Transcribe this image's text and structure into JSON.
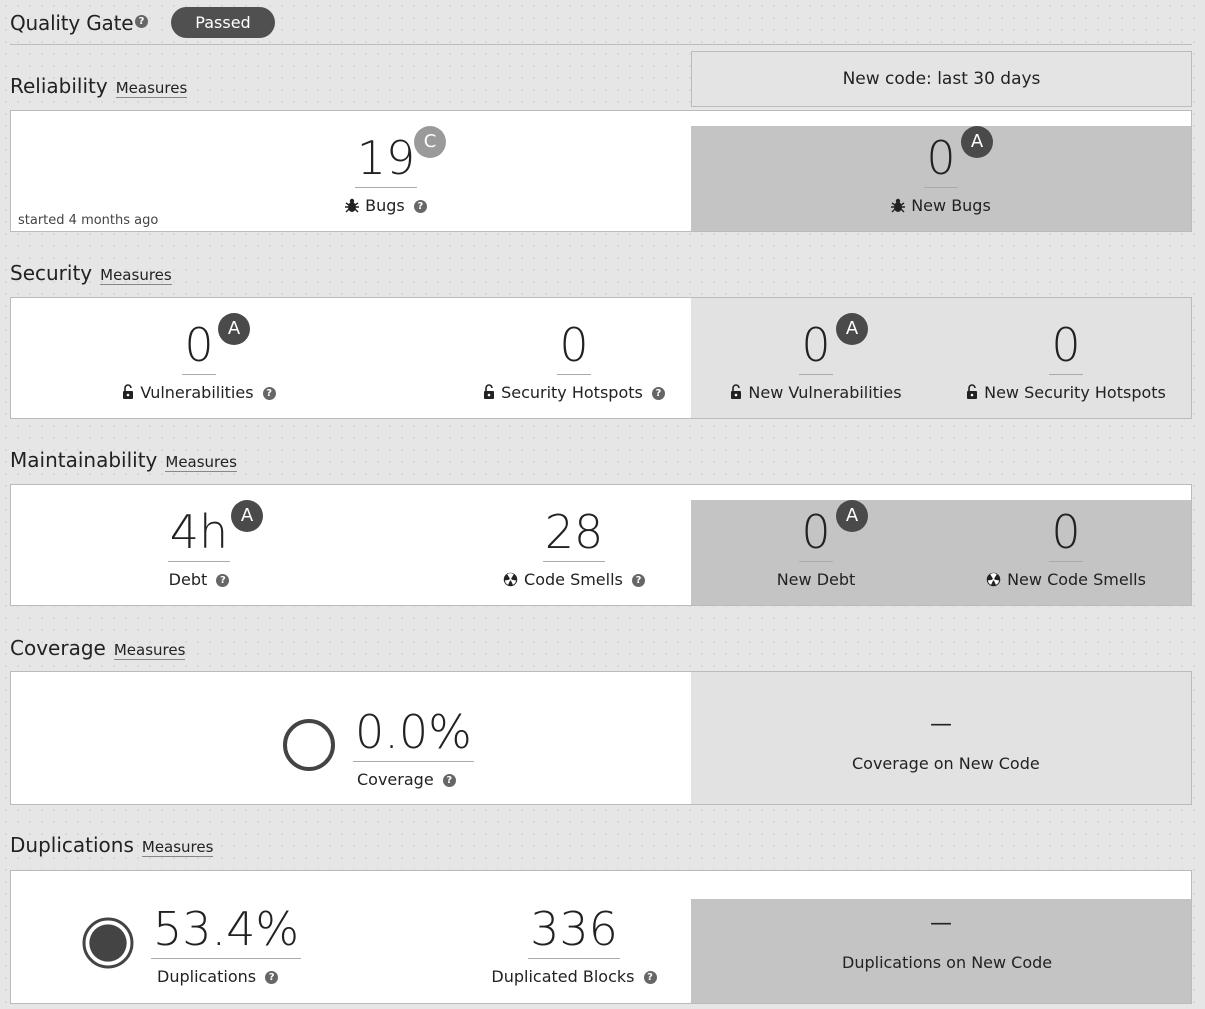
{
  "quality_gate": {
    "title": "Quality Gate",
    "status": "Passed"
  },
  "new_code_period": "New code: last 30 days",
  "measures_label": "Measures",
  "reliability": {
    "title": "Reliability",
    "started": "started 4 months ago",
    "bugs": {
      "value": "19",
      "rating": "C",
      "label": "Bugs"
    },
    "new_bugs": {
      "value": "0",
      "rating": "A",
      "label": "New Bugs"
    }
  },
  "security": {
    "title": "Security",
    "vulnerabilities": {
      "value": "0",
      "rating": "A",
      "label": "Vulnerabilities"
    },
    "hotspots": {
      "value": "0",
      "label": "Security Hotspots"
    },
    "new_vulnerabilities": {
      "value": "0",
      "rating": "A",
      "label": "New Vulnerabilities"
    },
    "new_hotspots": {
      "value": "0",
      "label": "New Security Hotspots"
    }
  },
  "maintainability": {
    "title": "Maintainability",
    "debt": {
      "value": "4h",
      "rating": "A",
      "label": "Debt"
    },
    "code_smells": {
      "value": "28",
      "label": "Code Smells"
    },
    "new_debt": {
      "value": "0",
      "rating": "A",
      "label": "New Debt"
    },
    "new_code_smells": {
      "value": "0",
      "label": "New Code Smells"
    }
  },
  "coverage": {
    "title": "Coverage",
    "coverage": {
      "value": "0.0%",
      "label": "Coverage",
      "percent": 0.0
    },
    "new_coverage": {
      "value": "—",
      "label": "Coverage on New Code"
    }
  },
  "duplications": {
    "title": "Duplications",
    "duplications": {
      "value": "53.4%",
      "label": "Duplications",
      "percent": 53.4
    },
    "duplicated_blocks": {
      "value": "336",
      "label": "Duplicated Blocks"
    },
    "new_duplications": {
      "value": "—",
      "label": "Duplications on New Code"
    }
  },
  "icons": {
    "help": "help-icon",
    "bug": "bug-icon",
    "lock": "unlock-icon",
    "smell": "code-smell-icon"
  }
}
